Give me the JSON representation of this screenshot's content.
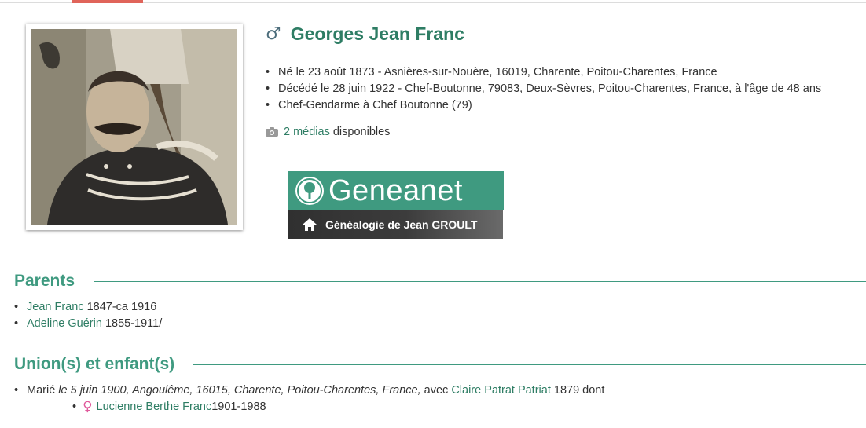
{
  "person": {
    "name": "Georges Jean Franc",
    "gender_icon": "male-icon"
  },
  "facts": [
    "Né le 23 août 1873 - Asnières-sur-Nouère, 16019, Charente, Poitou-Charentes, France",
    "Décédé le 28 juin 1922 - Chef-Boutonne, 79083, Deux-Sèvres, Poitou-Charentes, France, à l'âge de 48 ans",
    "Chef-Gendarme à Chef Boutonne (79)"
  ],
  "media": {
    "icon": "camera-icon",
    "link": "2 médias",
    "suffix": " disponibles"
  },
  "geneanet": {
    "brand": "Geneanet",
    "subtitle": "Généalogie de Jean GROULT",
    "color": "#3f9a80"
  },
  "parents": {
    "title": "Parents",
    "items": [
      {
        "name": "Jean Franc",
        "dates": " 1847-ca 1916"
      },
      {
        "name": "Adeline Guérin",
        "dates": " 1855-1911/"
      }
    ]
  },
  "unions": {
    "title": "Union(s) et enfant(s)",
    "marriage": {
      "prefix": "Marié ",
      "details": "le 5 juin 1900, Angoulême, 16015, Charente, Poitou-Charentes, France,",
      "with": " avec ",
      "spouse": "Claire Patrat Patriat",
      "suffix": " 1879 dont"
    },
    "child": {
      "name": "Lucienne Berthe Franc",
      "dates": " 1901-1988",
      "gender_icon": "female-icon"
    }
  },
  "colors": {
    "accent": "#2e7d64",
    "section": "#3f9a80",
    "top_tab": "#e0645a"
  }
}
